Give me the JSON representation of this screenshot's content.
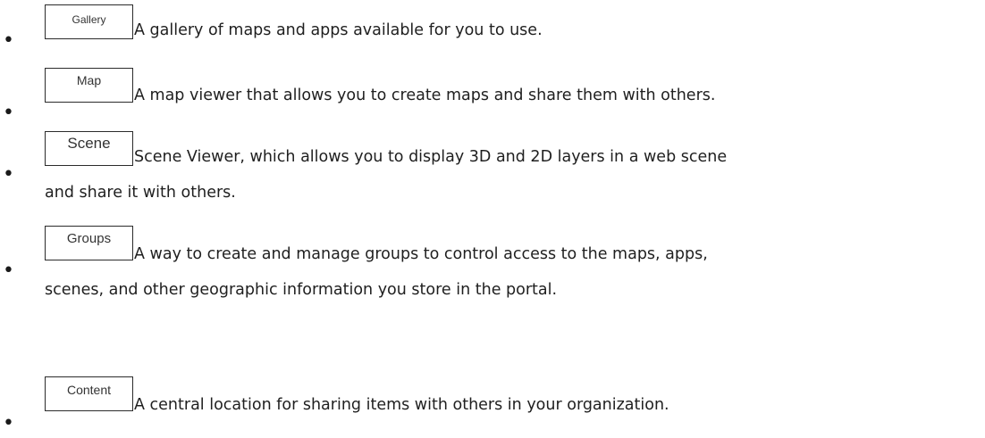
{
  "items": [
    {
      "button": "Gallery",
      "line1": "A gallery of maps and apps available for you to use.",
      "line2": ""
    },
    {
      "button": "Map",
      "line1": "A map viewer that allows you to create maps and share them with others.",
      "line2": ""
    },
    {
      "button": "Scene",
      "line1": "Scene Viewer, which allows you to display 3D and 2D layers in a web scene",
      "line2": "and share it with others."
    },
    {
      "button": "Groups",
      "line1": "A way to create and manage groups to control access to the maps, apps,",
      "line2": "scenes, and other geographic information you store in the portal."
    },
    {
      "button": "Content",
      "line1": "A central location for sharing items with others in your organization.",
      "line2": ""
    }
  ]
}
